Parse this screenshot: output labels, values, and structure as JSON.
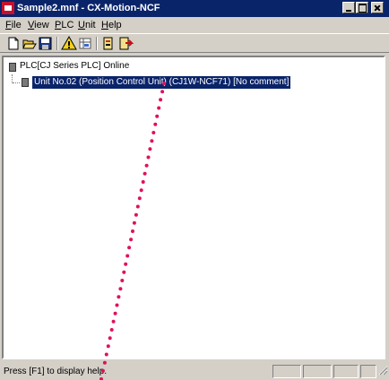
{
  "window": {
    "title": "Sample2.mnf - CX-Motion-NCF"
  },
  "menu": {
    "items": [
      "File",
      "View",
      "PLC",
      "Unit",
      "Help"
    ]
  },
  "toolbar": {
    "buttons": [
      "new-icon",
      "open-icon",
      "save-icon",
      "warning-icon",
      "unit-table-icon",
      "parameter-icon",
      "transfer-icon"
    ]
  },
  "tree": {
    "root_label": "PLC[CJ Series PLC] Online",
    "child_label": "Unit No.02 (Position Control Unit) (CJ1W-NCF71) [No comment]"
  },
  "statusbar": {
    "text": "Press [F1] to display help."
  },
  "colors": {
    "title_bar": "#0a246a",
    "selection": "#0a246a",
    "annotation_dots": "#e0105c",
    "window_face": "#d4d0c8"
  }
}
